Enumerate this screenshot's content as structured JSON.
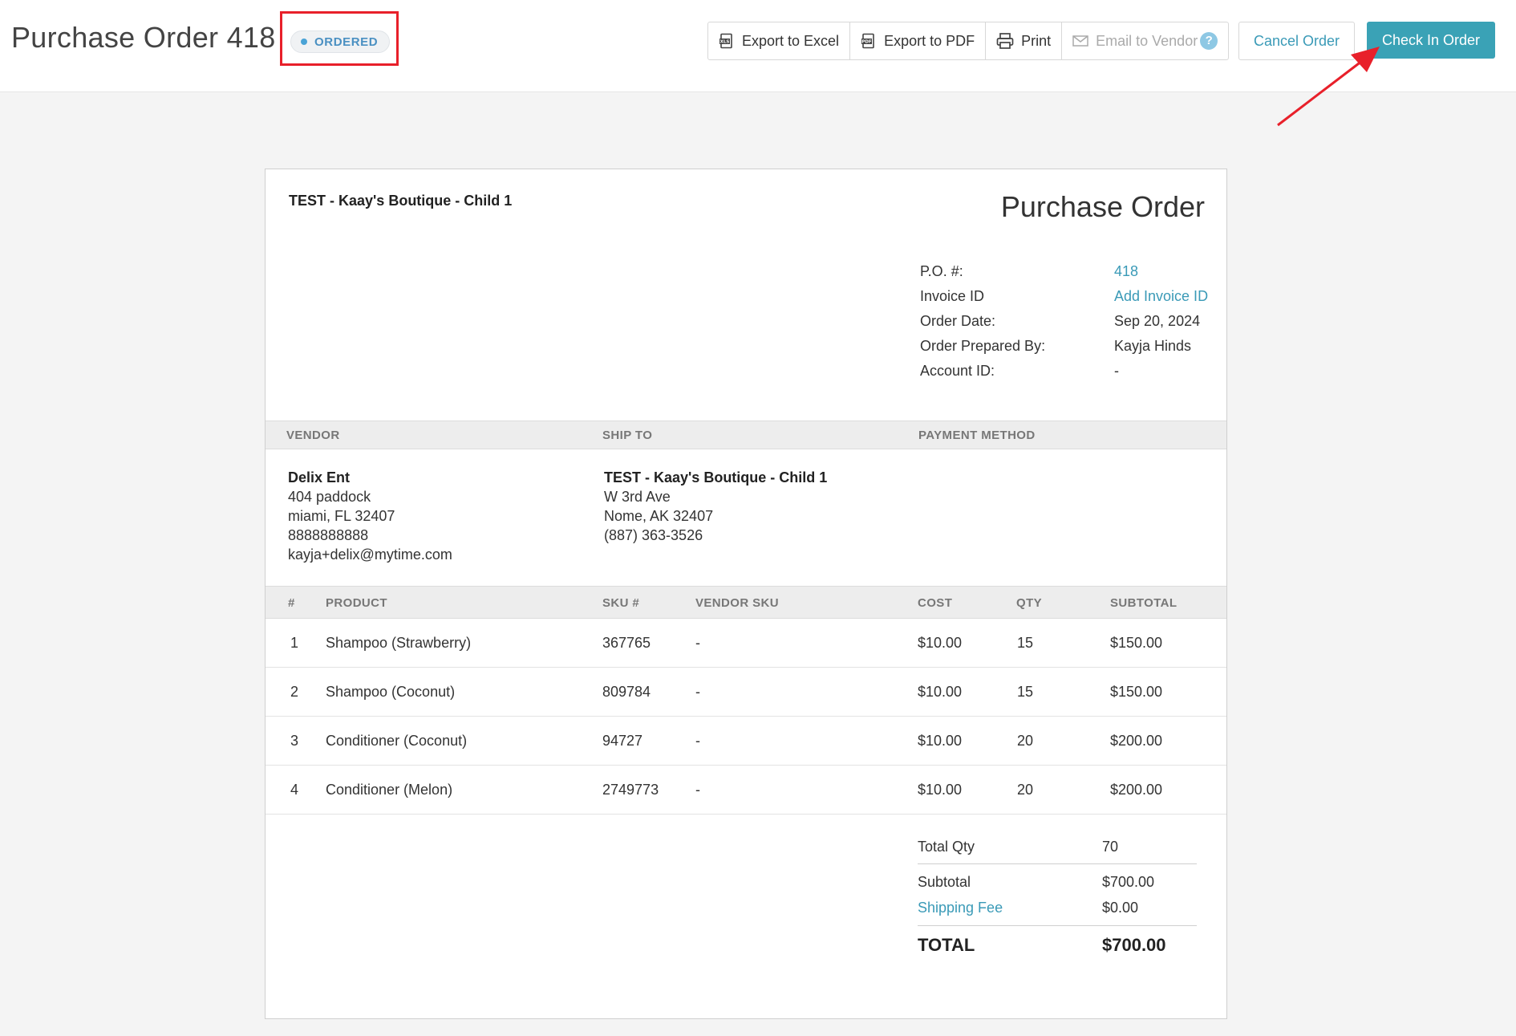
{
  "header": {
    "title": "Purchase Order 418",
    "status": "ORDERED",
    "actions": {
      "export_excel": "Export to Excel",
      "export_pdf": "Export to PDF",
      "print": "Print",
      "email_vendor": "Email to Vendor",
      "help": "?",
      "cancel": "Cancel Order",
      "check_in": "Check In Order"
    },
    "colors": {
      "accent": "#3aa2b6",
      "link": "#3a9ab7",
      "annotation": "#e8202a"
    }
  },
  "document": {
    "store_name": "TEST - Kaay's Boutique - Child 1",
    "title": "Purchase Order",
    "meta": [
      {
        "key": "P.O. #:",
        "value": "418"
      },
      {
        "key": "Invoice ID",
        "value": "Add Invoice ID"
      },
      {
        "key": "Order Date:",
        "value": "Sep 20, 2024"
      },
      {
        "key": "Order Prepared By:",
        "value": "Kayja Hinds"
      },
      {
        "key": "Account ID:",
        "value": "-"
      }
    ],
    "sections": {
      "vendor": "VENDOR",
      "ship_to": "SHIP TO",
      "payment": "PAYMENT METHOD"
    },
    "vendor": {
      "name": "Delix Ent",
      "line1": "404 paddock",
      "line2": "miami, FL 32407",
      "phone": "8888888888",
      "email": "kayja+delix@mytime.com"
    },
    "ship_to": {
      "name": "TEST - Kaay's Boutique - Child 1",
      "line1": "W 3rd Ave",
      "line2": "Nome, AK 32407",
      "phone": "(887) 363-3526"
    },
    "columns": {
      "num": "#",
      "product": "PRODUCT",
      "sku": "SKU #",
      "vendor_sku": "VENDOR SKU",
      "cost": "COST",
      "qty": "QTY",
      "subtotal": "SUBTOTAL"
    },
    "items": [
      {
        "num": "1",
        "product": "Shampoo (Strawberry)",
        "sku": "367765",
        "vendor_sku": "-",
        "cost": "$10.00",
        "qty": "15",
        "subtotal": "$150.00"
      },
      {
        "num": "2",
        "product": "Shampoo (Coconut)",
        "sku": "809784",
        "vendor_sku": "-",
        "cost": "$10.00",
        "qty": "15",
        "subtotal": "$150.00"
      },
      {
        "num": "3",
        "product": "Conditioner (Coconut)",
        "sku": "94727",
        "vendor_sku": "-",
        "cost": "$10.00",
        "qty": "20",
        "subtotal": "$200.00"
      },
      {
        "num": "4",
        "product": "Conditioner (Melon)",
        "sku": "2749773",
        "vendor_sku": "-",
        "cost": "$10.00",
        "qty": "20",
        "subtotal": "$200.00"
      }
    ],
    "totals": {
      "total_qty_label": "Total Qty",
      "total_qty": "70",
      "subtotal_label": "Subtotal",
      "subtotal": "$700.00",
      "shipping_label": "Shipping Fee",
      "shipping": "$0.00",
      "total_label": "TOTAL",
      "total": "$700.00"
    }
  }
}
